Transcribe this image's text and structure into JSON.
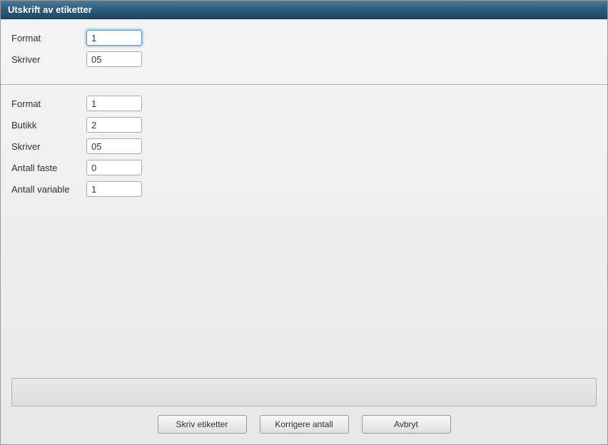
{
  "window": {
    "title": "Utskrift av etiketter"
  },
  "section1": {
    "format": {
      "label": "Format",
      "value": "1"
    },
    "skriver": {
      "label": "Skriver",
      "value": "05"
    }
  },
  "section2": {
    "format": {
      "label": "Format",
      "value": "1"
    },
    "butikk": {
      "label": "Butikk",
      "value": "2"
    },
    "skriver": {
      "label": "Skriver",
      "value": "05"
    },
    "antall_faste": {
      "label": "Antall faste",
      "value": "0"
    },
    "antall_variable": {
      "label": "Antall variable",
      "value": "1"
    }
  },
  "buttons": {
    "print": "Skriv etiketter",
    "correct": "Korrigere antall",
    "cancel": "Avbryt"
  }
}
